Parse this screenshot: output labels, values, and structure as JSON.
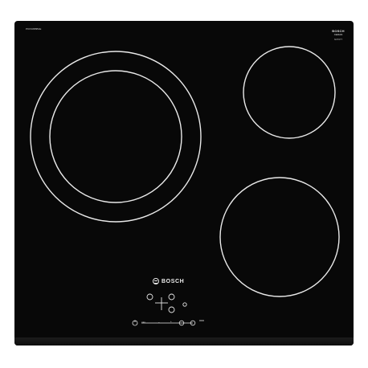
{
  "product": {
    "brand": "BOSCH",
    "model_code": "PKF645BB1E",
    "badge_title": "BOSCH",
    "badge_subtitle": "CERAN",
    "badge_small": "SCHOTT"
  },
  "controls": {
    "plus_label": "+",
    "minus_label": "−",
    "timer_label": "min"
  },
  "colors": {
    "glass": "#080808",
    "zone_lines": "#e9e9e9",
    "background": "#ffffff"
  }
}
